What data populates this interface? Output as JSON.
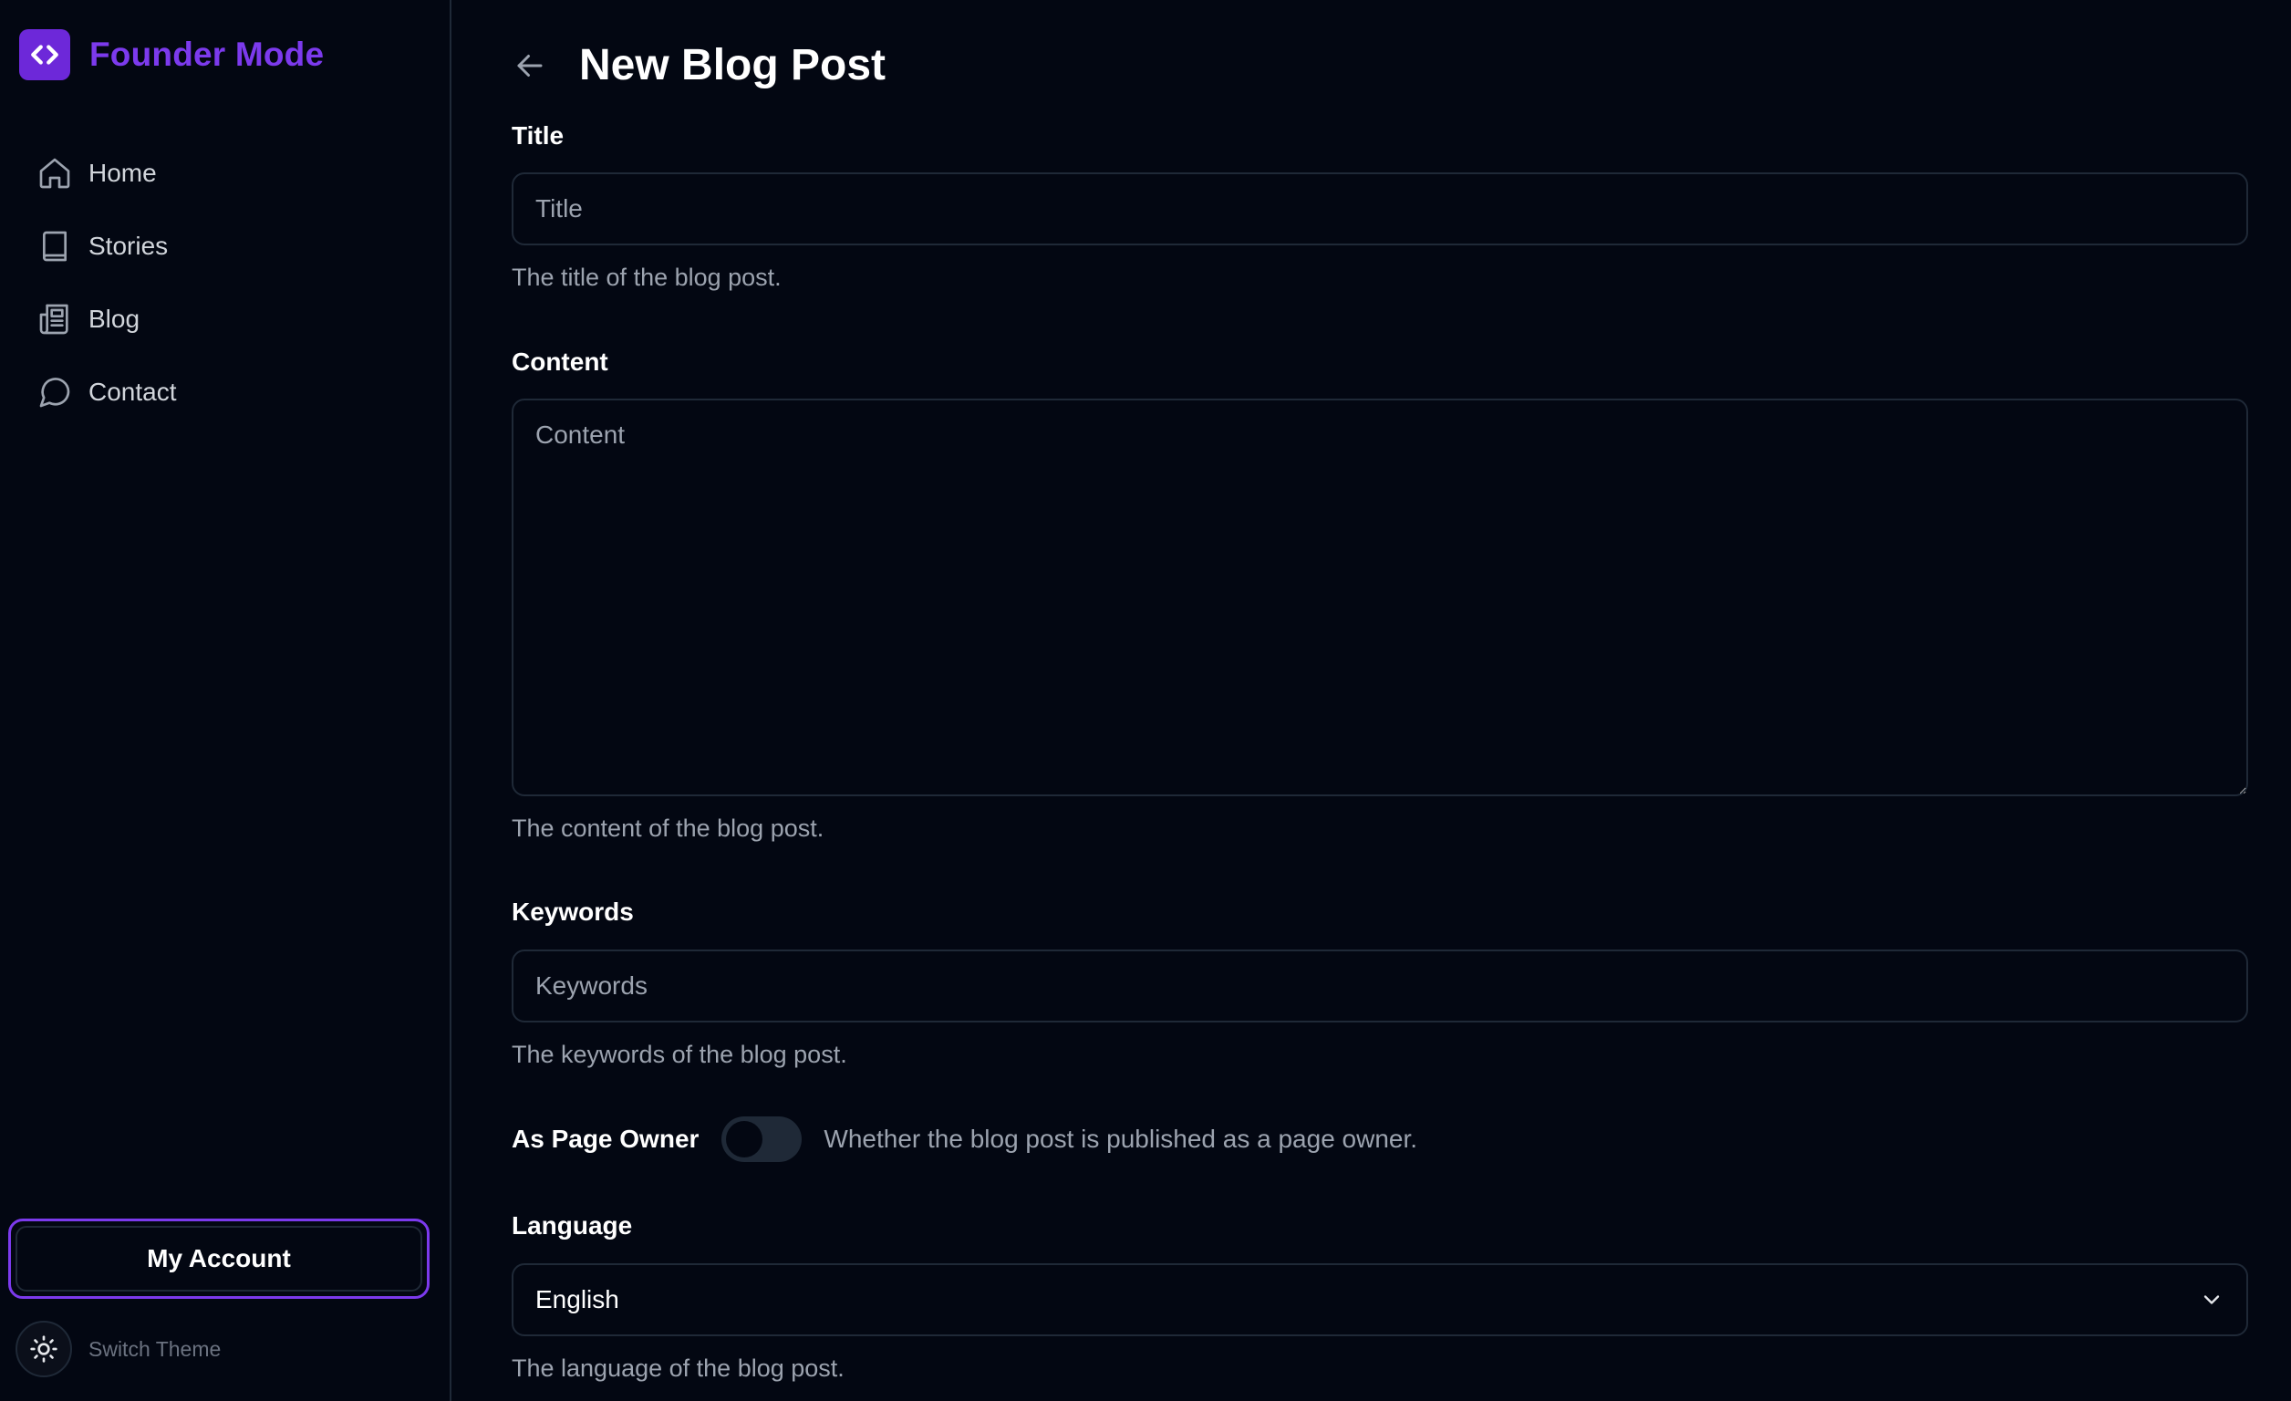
{
  "brand": {
    "name": "Founder Mode",
    "accent": "#7c3aed",
    "logo_icon": "code-brackets-icon"
  },
  "sidebar": {
    "items": [
      {
        "label": "Home",
        "icon": "home-icon"
      },
      {
        "label": "Stories",
        "icon": "book-icon"
      },
      {
        "label": "Blog",
        "icon": "newspaper-icon"
      },
      {
        "label": "Contact",
        "icon": "message-circle-icon"
      }
    ],
    "account_label": "My Account",
    "theme_label": "Switch Theme"
  },
  "header": {
    "title": "New Blog Post",
    "back_icon": "arrow-left-icon"
  },
  "form": {
    "title": {
      "label": "Title",
      "placeholder": "Title",
      "value": "",
      "help": "The title of the blog post."
    },
    "content": {
      "label": "Content",
      "placeholder": "Content",
      "value": "",
      "help": "The content of the blog post."
    },
    "keywords": {
      "label": "Keywords",
      "placeholder": "Keywords",
      "value": "",
      "help": "The keywords of the blog post."
    },
    "page_owner": {
      "label": "As Page Owner",
      "checked": false,
      "help": "Whether the blog post is published as a page owner."
    },
    "language": {
      "label": "Language",
      "value": "English",
      "help": "The language of the blog post."
    }
  }
}
